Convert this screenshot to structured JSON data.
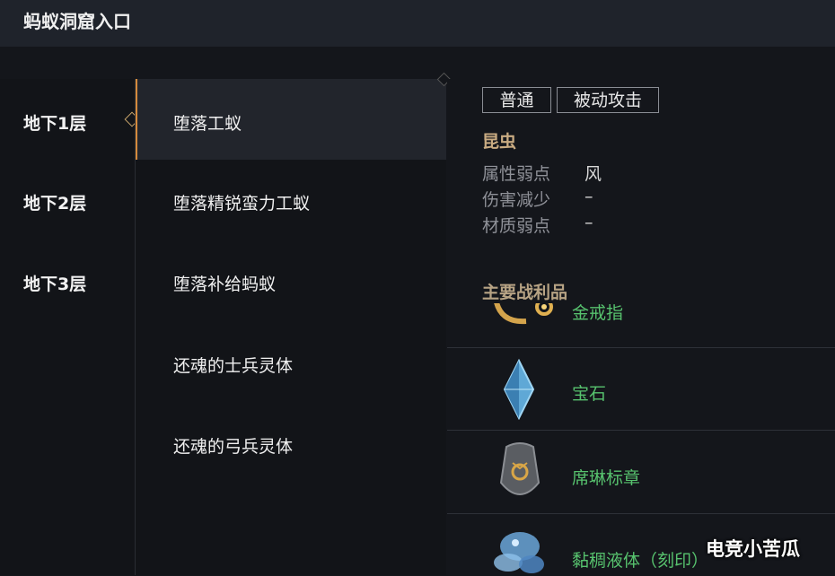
{
  "window": {
    "title": "蚂蚁洞窟入口"
  },
  "floors": [
    {
      "label": "地下1层",
      "active": true
    },
    {
      "label": "地下2层",
      "active": false
    },
    {
      "label": "地下3层",
      "active": false
    }
  ],
  "monsters": [
    {
      "label": "堕落工蚁",
      "active": true
    },
    {
      "label": "堕落精锐蛮力工蚁",
      "active": false
    },
    {
      "label": "堕落补给蚂蚁",
      "active": false
    },
    {
      "label": "还魂的士兵灵体",
      "active": false
    },
    {
      "label": "还魂的弓兵灵体",
      "active": false
    }
  ],
  "details": {
    "tags": [
      "普通",
      "被动攻击"
    ],
    "species": "昆虫",
    "attributes": [
      {
        "label": "属性弱点",
        "value": "风"
      },
      {
        "label": "伤害减少",
        "value": "–"
      },
      {
        "label": "材质弱点",
        "value": "–"
      }
    ],
    "loot_title": "主要战利品",
    "loot": [
      {
        "name": "金戒指",
        "icon": "gold-ring-icon"
      },
      {
        "name": "宝石",
        "icon": "blue-gem-icon"
      },
      {
        "name": "席琳标章",
        "icon": "emblem-stone-icon"
      },
      {
        "name": "黏稠液体（刻印）",
        "icon": "blue-liquid-icon"
      }
    ]
  },
  "watermark": "电竞小苦瓜",
  "colors": {
    "accent": "#d58a3c",
    "loot_name": "#57c26e",
    "species": "#c9ab82"
  }
}
